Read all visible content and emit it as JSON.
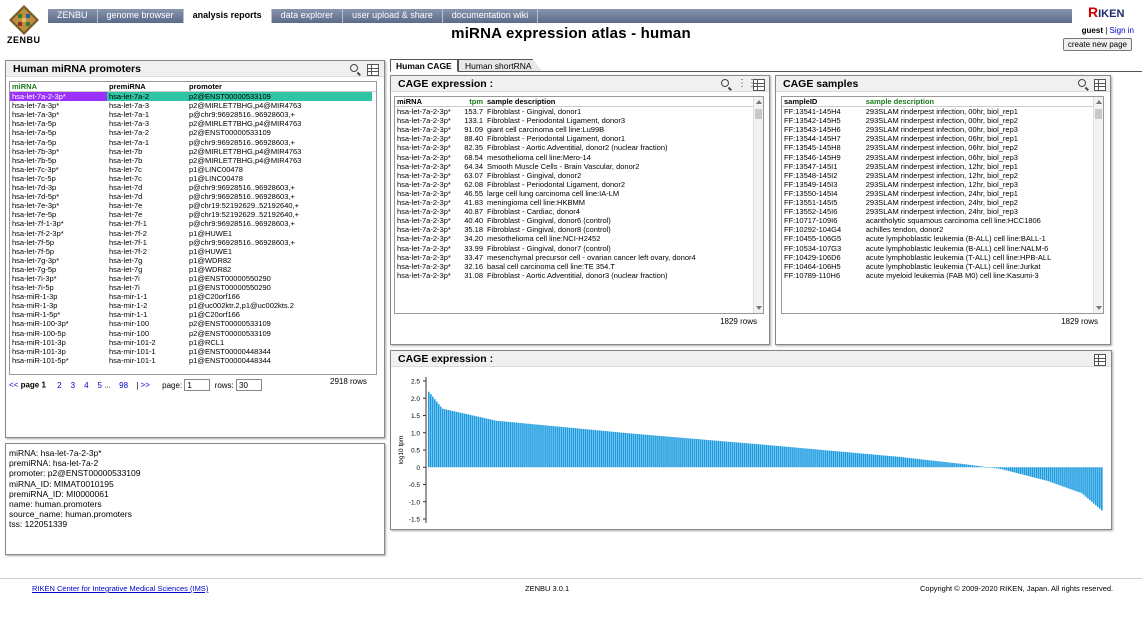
{
  "logo": {
    "text": "ZENBU"
  },
  "nav": {
    "tabs": [
      {
        "label": "ZENBU",
        "active": false
      },
      {
        "label": "genome browser",
        "active": false
      },
      {
        "label": "analysis reports",
        "active": true
      },
      {
        "label": "data explorer",
        "active": false
      },
      {
        "label": "user upload & share",
        "active": false
      },
      {
        "label": "documentation wiki",
        "active": false
      }
    ]
  },
  "brand": {
    "riken_letter": "R",
    "riken_text": "IKEN"
  },
  "user": {
    "name": "guest",
    "separator": "|",
    "signin": "Sign in",
    "create_page": "create new page"
  },
  "page_title": "miRNA expression atlas - human",
  "promoters": {
    "title": "Human miRNA promoters",
    "columns": [
      "miRNA",
      "premiRNA",
      "promoter"
    ],
    "rows": [
      [
        "hsa-let-7a-2-3p*",
        "hsa-let-7a-2",
        "p2@ENST00000533109"
      ],
      [
        "hsa-let-7a-3p*",
        "hsa-let-7a-3",
        "p2@MIRLET7BHG,p4@MIR4763"
      ],
      [
        "hsa-let-7a-3p*",
        "hsa-let-7a-1",
        "p@chr9:96928516..96928603,+"
      ],
      [
        "hsa-let-7a-5p",
        "hsa-let-7a-3",
        "p2@MIRLET7BHG,p4@MIR4763"
      ],
      [
        "hsa-let-7a-5p",
        "hsa-let-7a-2",
        "p2@ENST00000533109"
      ],
      [
        "hsa-let-7a-5p",
        "hsa-let-7a-1",
        "p@chr9:96928516..96928603,+"
      ],
      [
        "hsa-let-7b-3p*",
        "hsa-let-7b",
        "p2@MIRLET7BHG,p4@MIR4763"
      ],
      [
        "hsa-let-7b-5p",
        "hsa-let-7b",
        "p2@MIRLET7BHG,p4@MIR4763"
      ],
      [
        "hsa-let-7c-3p*",
        "hsa-let-7c",
        "p1@LINC00478"
      ],
      [
        "hsa-let-7c-5p",
        "hsa-let-7c",
        "p1@LINC00478"
      ],
      [
        "hsa-let-7d-3p",
        "hsa-let-7d",
        "p@chr9:96928516..96928603,+"
      ],
      [
        "hsa-let-7d-5p*",
        "hsa-let-7d",
        "p@chr9:96928516..96928603,+"
      ],
      [
        "hsa-let-7e-3p*",
        "hsa-let-7e",
        "p@chr19:52192629..52192640,+"
      ],
      [
        "hsa-let-7e-5p",
        "hsa-let-7e",
        "p@chr19:52192629..52192640,+"
      ],
      [
        "hsa-let-7f-1-3p*",
        "hsa-let-7f-1",
        "p@chr9:96928516..96928603,+"
      ],
      [
        "hsa-let-7f-2-3p*",
        "hsa-let-7f-2",
        "p1@HUWE1"
      ],
      [
        "hsa-let-7f-5p",
        "hsa-let-7f-1",
        "p@chr9:96928516..96928603,+"
      ],
      [
        "hsa-let-7f-5p",
        "hsa-let-7f-2",
        "p1@HUWE1"
      ],
      [
        "hsa-let-7g-3p*",
        "hsa-let-7g",
        "p1@WDR82"
      ],
      [
        "hsa-let-7g-5p",
        "hsa-let-7g",
        "p1@WDR82"
      ],
      [
        "hsa-let-7i-3p*",
        "hsa-let-7i",
        "p1@ENST00000550290"
      ],
      [
        "hsa-let-7i-5p",
        "hsa-let-7i",
        "p1@ENST00000550290"
      ],
      [
        "hsa-miR-1-3p",
        "hsa-mir-1-1",
        "p1@C20orf166"
      ],
      [
        "hsa-miR-1-3p",
        "hsa-mir-1-2",
        "p1@uc002ktr.2,p1@uc002kts.2"
      ],
      [
        "hsa-miR-1-5p*",
        "hsa-mir-1-1",
        "p1@C20orf166"
      ],
      [
        "hsa-miR-100-3p*",
        "hsa-mir-100",
        "p2@ENST00000533109"
      ],
      [
        "hsa-miR-100-5p",
        "hsa-mir-100",
        "p2@ENST00000533109"
      ],
      [
        "hsa-miR-101-3p",
        "hsa-mir-101-2",
        "p1@RCL1"
      ],
      [
        "hsa-miR-101-3p",
        "hsa-mir-101-1",
        "p1@ENST00000448344"
      ],
      [
        "hsa-miR-101-5p*",
        "hsa-mir-101-1",
        "p1@ENST00000448344"
      ]
    ],
    "pager": {
      "prev": "<<",
      "page_label": "page",
      "current": "1",
      "pages": [
        "2",
        "3",
        "4",
        "5"
      ],
      "ellipsis": "...",
      "last": "98",
      "sep": "|",
      "next": ">>",
      "page_input_label": "page:",
      "page_value": "1",
      "rows_label": "rows:",
      "rows_value": "30"
    },
    "total": "2918 rows"
  },
  "details": {
    "lines": [
      "miRNA: hsa-let-7a-2-3p*",
      "premiRNA: hsa-let-7a-2",
      "promoter: p2@ENST00000533109",
      "miRNA_ID: MIMAT0010195",
      "premiRNA_ID: MI0000061",
      "name: human.promoters",
      "source_name: human.promoters",
      "tss: 122051339"
    ]
  },
  "tabs": [
    {
      "label": "Human CAGE",
      "active": true
    },
    {
      "label": "Human shortRNA",
      "active": false
    }
  ],
  "cage_expr": {
    "title": "CAGE expression :",
    "columns": [
      "miRNA",
      "tpm",
      "sample description"
    ],
    "rows": [
      [
        "hsa-let-7a-2-3p*",
        "153.7",
        "Fibroblast - Gingival, donor1"
      ],
      [
        "hsa-let-7a-2-3p*",
        "133.1",
        "Fibroblast - Periodontal Ligament, donor3"
      ],
      [
        "hsa-let-7a-2-3p*",
        "91.09",
        "giant cell carcinoma cell line:Lu99B"
      ],
      [
        "hsa-let-7a-2-3p*",
        "88.40",
        "Fibroblast - Periodontal Ligament, donor1"
      ],
      [
        "hsa-let-7a-2-3p*",
        "82.35",
        "Fibroblast - Aortic Adventitial, donor2 (nuclear fraction)"
      ],
      [
        "hsa-let-7a-2-3p*",
        "68.54",
        "mesothelioma cell line:Mero-14"
      ],
      [
        "hsa-let-7a-2-3p*",
        "64.34",
        "Smooth Muscle Cells - Brain Vascular, donor2"
      ],
      [
        "hsa-let-7a-2-3p*",
        "63.07",
        "Fibroblast - Gingival, donor2"
      ],
      [
        "hsa-let-7a-2-3p*",
        "62.08",
        "Fibroblast - Periodontal Ligament, donor2"
      ],
      [
        "hsa-let-7a-2-3p*",
        "46.55",
        "large cell lung carcinoma cell line:IA-LM"
      ],
      [
        "hsa-let-7a-2-3p*",
        "41.83",
        "meningioma cell line:HKBMM"
      ],
      [
        "hsa-let-7a-2-3p*",
        "40.87",
        "Fibroblast - Cardiac, donor4"
      ],
      [
        "hsa-let-7a-2-3p*",
        "40.40",
        "Fibroblast - Gingival, donor6 (control)"
      ],
      [
        "hsa-let-7a-2-3p*",
        "35.18",
        "Fibroblast - Gingival, donor8 (control)"
      ],
      [
        "hsa-let-7a-2-3p*",
        "34.20",
        "mesothelioma cell line:NCI-H2452"
      ],
      [
        "hsa-let-7a-2-3p*",
        "33.99",
        "Fibroblast - Gingival, donor7 (control)"
      ],
      [
        "hsa-let-7a-2-3p*",
        "33.47",
        "mesenchymal precursor cell - ovarian cancer left ovary, donor4"
      ],
      [
        "hsa-let-7a-2-3p*",
        "32.16",
        "basal cell carcinoma cell line:TE 354.T"
      ],
      [
        "hsa-let-7a-2-3p*",
        "31.08",
        "Fibroblast - Aortic Adventitial, donor3 (nuclear fraction)"
      ]
    ],
    "total": "1829 rows"
  },
  "cage_samples": {
    "title": "CAGE samples",
    "columns": [
      "sampleID",
      "sample description"
    ],
    "rows": [
      [
        "FF:13541-145H4",
        "293SLAM rinderpest infection, 00hr, biol_rep1"
      ],
      [
        "FF:13542-145H5",
        "293SLAM rinderpest infection, 00hr, biol_rep2"
      ],
      [
        "FF:13543-145H6",
        "293SLAM rinderpest infection, 00hr, biol_rep3"
      ],
      [
        "FF:13544-145H7",
        "293SLAM rinderpest infection, 06hr, biol_rep1"
      ],
      [
        "FF:13545-145H8",
        "293SLAM rinderpest infection, 06hr, biol_rep2"
      ],
      [
        "FF:13546-145H9",
        "293SLAM rinderpest infection, 06hr, biol_rep3"
      ],
      [
        "FF:13547-145I1",
        "293SLAM rinderpest infection, 12hr, biol_rep1"
      ],
      [
        "FF:13548-145I2",
        "293SLAM rinderpest infection, 12hr, biol_rep2"
      ],
      [
        "FF:13549-145I3",
        "293SLAM rinderpest infection, 12hr, biol_rep3"
      ],
      [
        "FF:13550-145I4",
        "293SLAM rinderpest infection, 24hr, biol_rep1"
      ],
      [
        "FF:13551-145I5",
        "293SLAM rinderpest infection, 24hr, biol_rep2"
      ],
      [
        "FF:13552-145I6",
        "293SLAM rinderpest infection, 24hr, biol_rep3"
      ],
      [
        "FF:10717-109I6",
        "acantholytic squamous carcinoma cell line:HCC1806"
      ],
      [
        "FF:10292-104G4",
        "achilles tendon, donor2"
      ],
      [
        "FF:10455-106G5",
        "acute lymphoblastic leukemia (B-ALL) cell line:BALL-1"
      ],
      [
        "FF:10534-107G3",
        "acute lymphoblastic leukemia (B-ALL) cell line:NALM-6"
      ],
      [
        "FF:10429-106D6",
        "acute lymphoblastic leukemia (T-ALL) cell line:HPB-ALL"
      ],
      [
        "FF:10464-106H5",
        "acute lymphoblastic leukemia (T-ALL) cell line:Jurkat"
      ],
      [
        "FF:10789-110H6",
        "acute myeloid leukemia (FAB M0) cell line:Kasumi-3"
      ]
    ],
    "total": "1829 rows"
  },
  "chart_panel": {
    "title": "CAGE expression :"
  },
  "chart_data": {
    "type": "bar",
    "title": "",
    "xlabel": "",
    "ylabel": "log10 tpm",
    "ylim": [
      -1.5,
      2.2
    ],
    "yticks": [
      "2.5",
      "2.0",
      "1.5",
      "1.0",
      "0.5",
      "0",
      "-0.5",
      "-1.0",
      "-1.5"
    ],
    "n_bars": 340,
    "color": "#1a9be0",
    "grid": false,
    "profile": [
      [
        0,
        2.19
      ],
      [
        0.02,
        1.7
      ],
      [
        0.1,
        1.35
      ],
      [
        0.3,
        0.98
      ],
      [
        0.5,
        0.65
      ],
      [
        0.7,
        0.3
      ],
      [
        0.8,
        0.08
      ],
      [
        0.85,
        -0.05
      ],
      [
        0.92,
        -0.4
      ],
      [
        0.97,
        -0.75
      ],
      [
        1.0,
        -1.25
      ]
    ]
  },
  "footer": {
    "link": "RIKEN Center for Integrative Medical Sciences (IMS)",
    "version": "ZENBU 3.0.1",
    "copyright": "Copyright © 2009-2020 RIKEN, Japan. All rights reserved."
  }
}
